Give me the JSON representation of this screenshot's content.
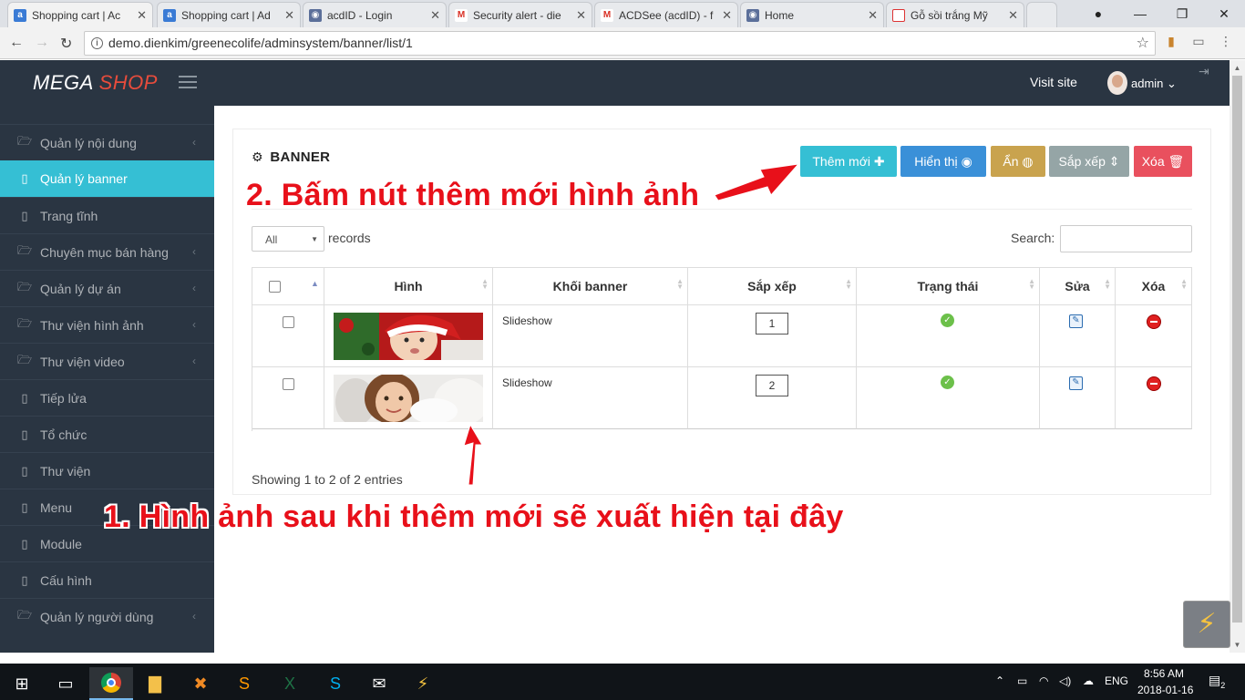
{
  "browser": {
    "tabs": [
      {
        "title": "Shopping cart | Ac",
        "active": true
      },
      {
        "title": "Shopping cart | Ad"
      },
      {
        "title": "acdID - Login"
      },
      {
        "title": "Security alert - die"
      },
      {
        "title": "ACDSee (acdID) - f"
      },
      {
        "title": "Home"
      },
      {
        "title": "Gỗ sồi trắng Mỹ"
      }
    ],
    "url": "demo.dienkim/greenecolife/adminsystem/banner/list/1"
  },
  "header": {
    "logo_mega": "MEGA",
    "logo_shop": "SHOP",
    "visit_site": "Visit site",
    "user": "admin"
  },
  "sidebar": {
    "items": [
      {
        "label": "Quản lý nội dung",
        "icon": "folder-icon",
        "submenu": true
      },
      {
        "label": "Quản lý banner",
        "icon": "file-icon",
        "active": true
      },
      {
        "label": "Trang tĩnh",
        "icon": "file-icon"
      },
      {
        "label": "Chuyên mục bán hàng",
        "icon": "folder-icon",
        "submenu": true
      },
      {
        "label": "Quản lý dự án",
        "icon": "folder-icon",
        "submenu": true
      },
      {
        "label": "Thư viện hình ảnh",
        "icon": "folder-icon",
        "submenu": true
      },
      {
        "label": "Thư viện video",
        "icon": "folder-icon",
        "submenu": true
      },
      {
        "label": "Tiếp lửa",
        "icon": "file-icon"
      },
      {
        "label": "Tổ chức",
        "icon": "file-icon"
      },
      {
        "label": "Thư viện",
        "icon": "file-icon"
      },
      {
        "label": "Menu",
        "icon": "file-icon"
      },
      {
        "label": "Module",
        "icon": "file-icon"
      },
      {
        "label": "Cấu hình",
        "icon": "file-icon"
      },
      {
        "label": "Quản lý người dùng",
        "icon": "folder-icon",
        "submenu": true
      }
    ]
  },
  "panel": {
    "title": "BANNER",
    "buttons": {
      "add": "Thêm mới",
      "show": "Hiển thị",
      "hide": "Ẩn",
      "sort": "Sắp xếp",
      "delete": "Xóa"
    },
    "length_value": "All",
    "records_label": "records",
    "search_label": "Search:",
    "columns": [
      "Hình",
      "Khối banner",
      "Sắp xếp",
      "Trạng thái",
      "Sửa",
      "Xóa"
    ],
    "rows": [
      {
        "block": "Slideshow",
        "order": "1"
      },
      {
        "block": "Slideshow",
        "order": "2"
      }
    ],
    "info": "Showing 1 to 2 of 2 entries"
  },
  "annotations": {
    "step2": "2. Bấm nút thêm mới hình ảnh",
    "step1": "1. Hình ảnh sau khi thêm mới sẽ xuất hiện tại đây"
  },
  "taskbar": {
    "lang": "ENG",
    "time": "8:56 AM",
    "date": "2018-01-16",
    "notif_count": "2"
  },
  "colors": {
    "sidebar_bg": "#2a3542",
    "active_teal": "#35bfd4",
    "btn_add": "#35bfd4",
    "btn_show": "#3a90d8",
    "btn_hide": "#c9a34e",
    "btn_sort": "#95a5a6",
    "btn_delete": "#e9505e",
    "annotation_red": "#e8101a"
  }
}
